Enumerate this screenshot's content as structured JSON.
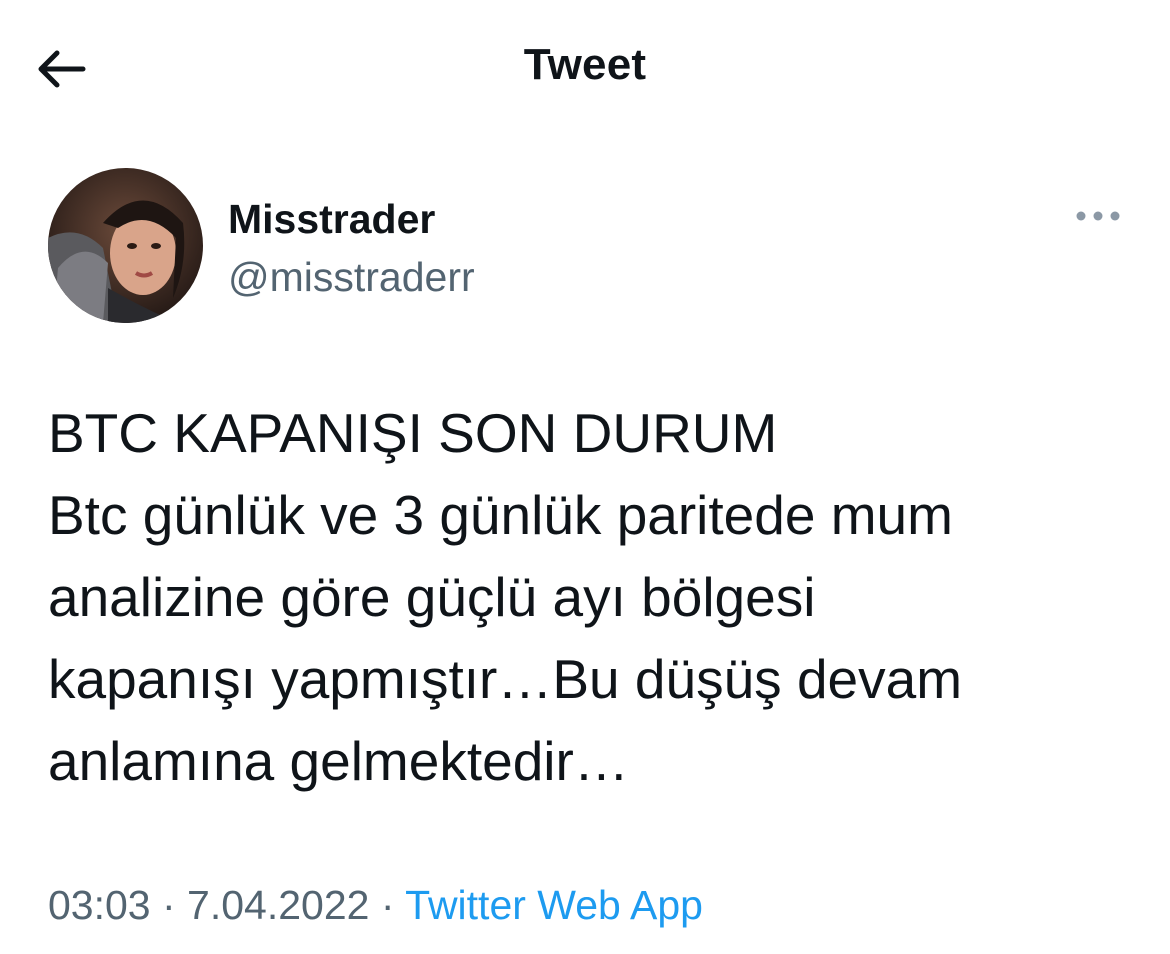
{
  "header": {
    "title": "Tweet",
    "back_icon": "arrow-left-icon"
  },
  "author": {
    "name": "Misstrader",
    "handle": "@misstraderr",
    "more_icon": "more-horizontal-icon"
  },
  "tweet": {
    "lines": [
      "BTC KAPANIŞI SON DURUM",
      "Btc günlük ve 3 günlük paritede mum",
      "analizine göre güçlü ayı bölgesi",
      "kapanışı yapmıştır…Bu düşüş devam",
      "anlamına gelmektedir…"
    ]
  },
  "meta": {
    "time": "03:03",
    "separator": " · ",
    "date": "7.04.2022",
    "source": "Twitter Web App"
  },
  "colors": {
    "text": "#0f1419",
    "secondary": "#536471",
    "link": "#1d9bf0"
  }
}
